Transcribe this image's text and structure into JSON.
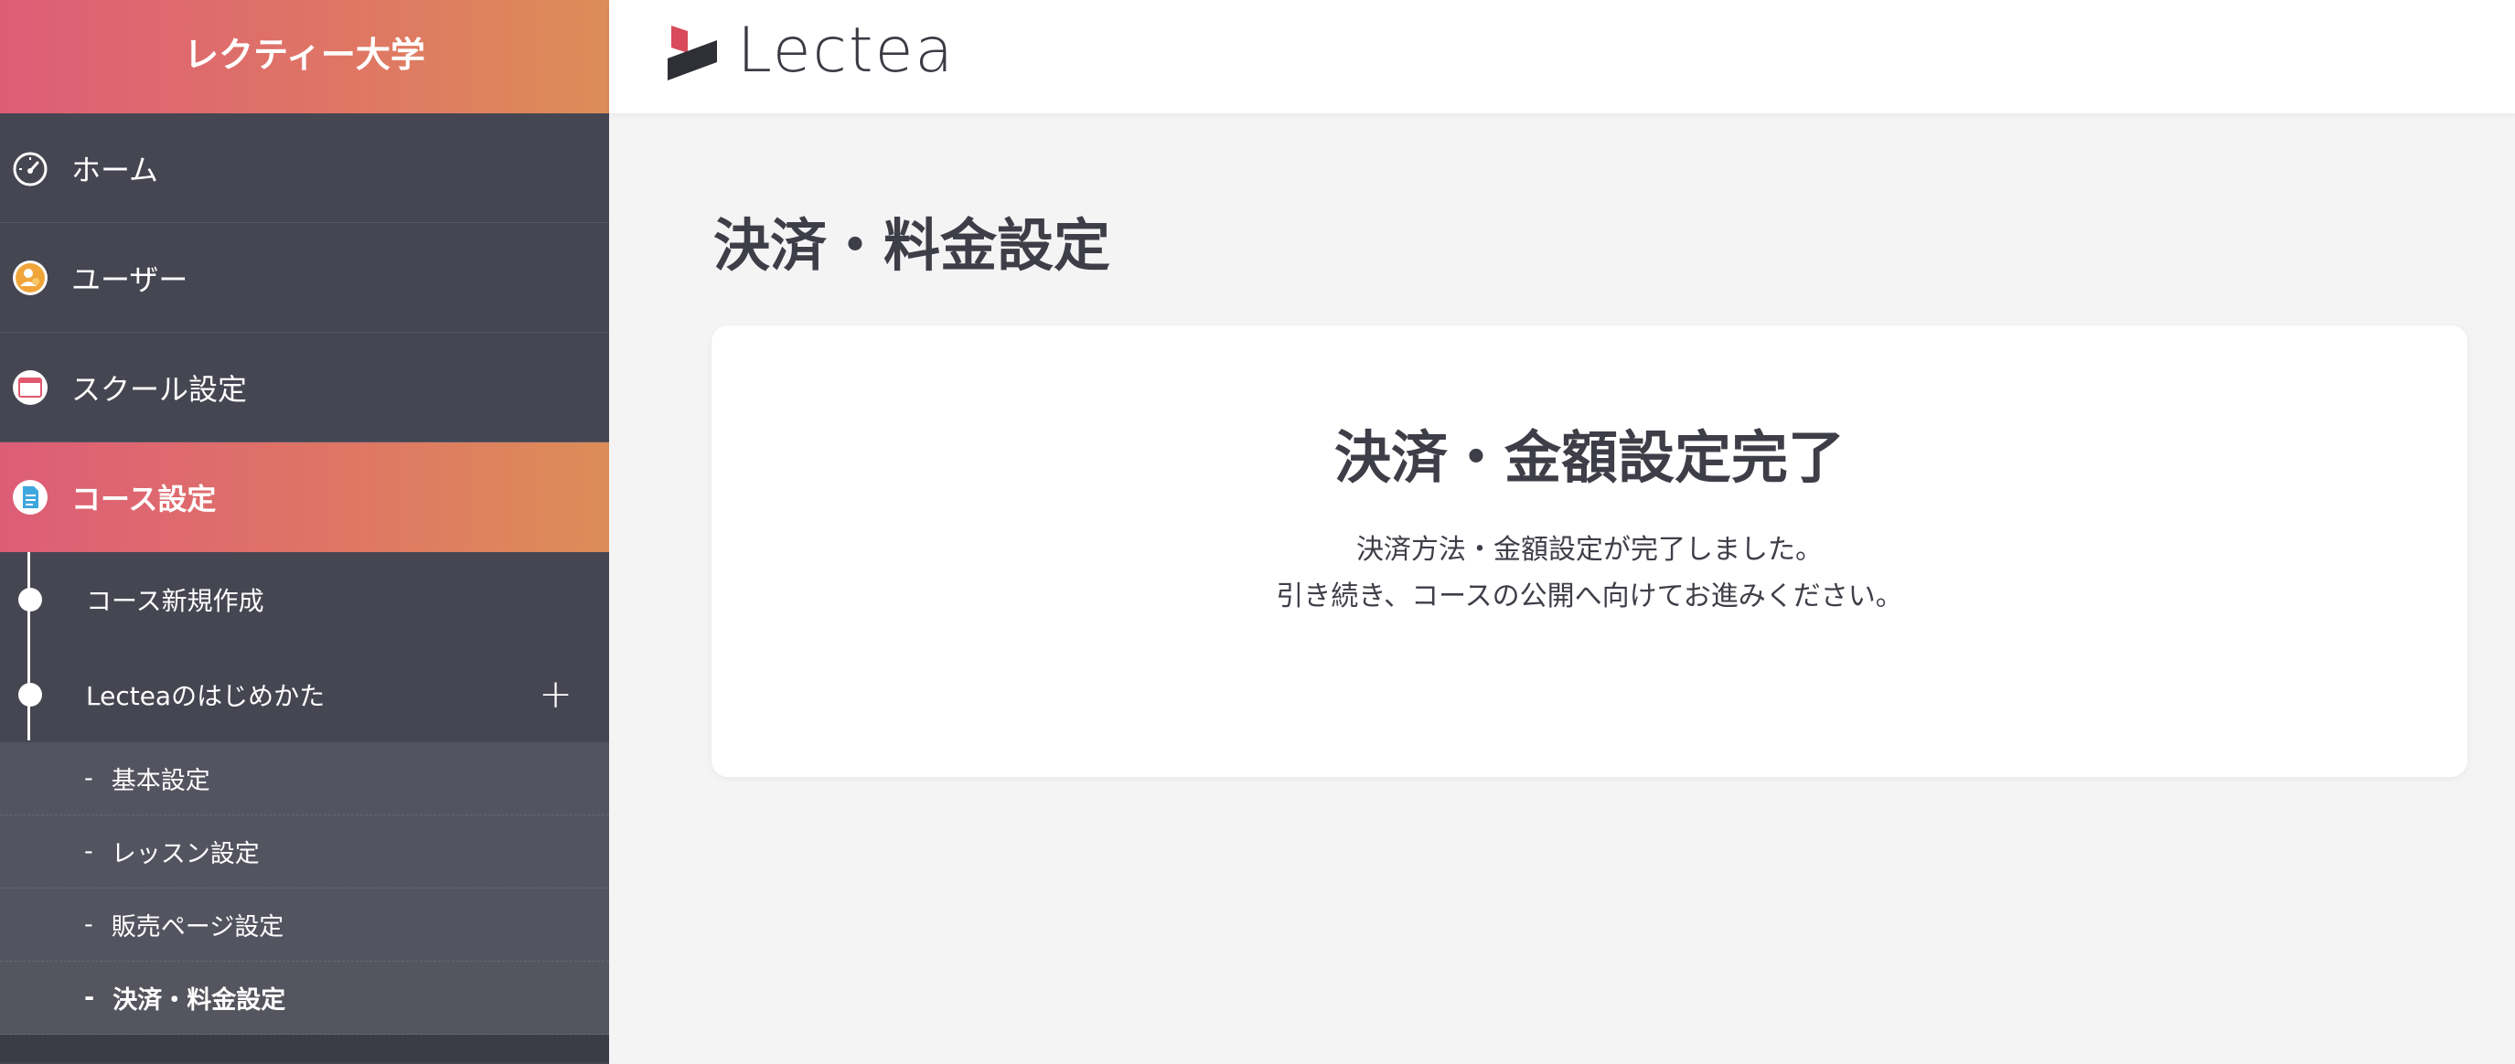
{
  "sidebar": {
    "school_name": "レクティー大学",
    "items": [
      {
        "label": "ホーム",
        "icon": "speedometer-icon"
      },
      {
        "label": "ユーザー",
        "icon": "user-icon"
      },
      {
        "label": "スクール設定",
        "icon": "browser-window-icon"
      },
      {
        "label": "コース設定",
        "icon": "document-icon"
      }
    ],
    "sub_items": [
      {
        "label": "コース新規作成"
      },
      {
        "label": "Lecteaのはじめかた",
        "expand_icon": "plus-icon"
      }
    ],
    "sub_sub_items": [
      {
        "dash": "-",
        "label": "基本設定"
      },
      {
        "dash": "-",
        "label": "レッスン設定"
      },
      {
        "dash": "-",
        "label": "販売ページ設定"
      },
      {
        "dash": "-",
        "label": "決済・料金設定"
      }
    ]
  },
  "header": {
    "logo_text": "Lectea"
  },
  "main": {
    "page_title": "決済・料金設定",
    "card": {
      "title": "決済・金額設定完了",
      "line1": "決済方法・金額設定が完了しました。",
      "line2": "引き続き、コースの公開へ向けてお進みください。"
    }
  },
  "colors": {
    "sidebar_bg": "#464652",
    "accent_gradient_start": "#dd5d77",
    "accent_gradient_end": "#dc8d58",
    "text_dark": "#3e3e48",
    "page_bg": "#f4f4f5"
  }
}
